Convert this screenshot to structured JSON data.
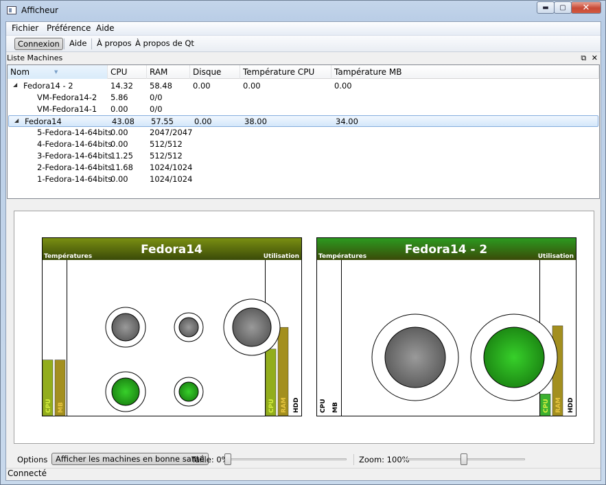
{
  "window": {
    "title": "Afficheur"
  },
  "menu": {
    "items": [
      "Fichier",
      "Préférence",
      "Aide"
    ]
  },
  "toolbar": {
    "connexion": "Connexion",
    "aide": "Aide",
    "apropos": "À propos",
    "apropos_qt": "À propos de Qt"
  },
  "dock": {
    "title": "Liste Machines"
  },
  "table": {
    "columns": [
      "Nom",
      "CPU",
      "RAM",
      "Disque",
      "Température CPU",
      "Tampérature MB"
    ],
    "rows": [
      {
        "level": 0,
        "expanded": true,
        "name": "Fedora14 - 2",
        "cpu": "14.32",
        "ram": "58.48",
        "disk": "0.00",
        "tcpu": "0.00",
        "tmb": "0.00"
      },
      {
        "level": 1,
        "name": "VM-Fedora14-2",
        "cpu": "5.86",
        "ram": "0/0",
        "disk": "",
        "tcpu": "",
        "tmb": ""
      },
      {
        "level": 1,
        "name": "VM-Fedora14-1",
        "cpu": "0.00",
        "ram": "0/0",
        "disk": "",
        "tcpu": "",
        "tmb": ""
      },
      {
        "level": 0,
        "expanded": true,
        "selected": true,
        "name": "Fedora14",
        "cpu": "43.08",
        "ram": "57.55",
        "disk": "0.00",
        "tcpu": "38.00",
        "tmb": "34.00"
      },
      {
        "level": 1,
        "name": "5-Fedora-14-64bits",
        "cpu": "0.00",
        "ram": "2047/2047",
        "disk": "",
        "tcpu": "",
        "tmb": ""
      },
      {
        "level": 1,
        "name": "4-Fedora-14-64bits",
        "cpu": "0.00",
        "ram": "512/512",
        "disk": "",
        "tcpu": "",
        "tmb": ""
      },
      {
        "level": 1,
        "name": "3-Fedora-14-64bits",
        "cpu": "11.25",
        "ram": "512/512",
        "disk": "",
        "tcpu": "",
        "tmb": ""
      },
      {
        "level": 1,
        "name": "2-Fedora-14-64bits",
        "cpu": "11.68",
        "ram": "1024/1024",
        "disk": "",
        "tcpu": "",
        "tmb": ""
      },
      {
        "level": 1,
        "name": "1-Fedora-14-64bits",
        "cpu": "0.00",
        "ram": "1024/1024",
        "disk": "",
        "tcpu": "",
        "tmb": ""
      }
    ]
  },
  "cards": [
    {
      "name": "Fedora14",
      "header_color": "#7a8f12",
      "temp_label": "Températures",
      "util_label": "Utilisation",
      "temp_bars": [
        {
          "label": "CPU",
          "level": 0.36,
          "color": "#92ad1c",
          "text_color": "#d8f040"
        },
        {
          "label": "MB",
          "level": 0.36,
          "color": "#a38f1f",
          "text_color": "#e8c640"
        }
      ],
      "util_bars": [
        {
          "label": "CPU",
          "level": 0.43,
          "color": "#92ad1c",
          "text_color": "#d8f040"
        },
        {
          "label": "RAM",
          "level": 0.57,
          "color": "#a38f1f",
          "text_color": "#e8c640"
        },
        {
          "label": "HDD",
          "level": 0.0,
          "color": "#777777",
          "text_color": "#000000"
        }
      ],
      "vm_circles": [
        {
          "size": "medium",
          "state": "idle"
        },
        {
          "size": "small",
          "state": "idle"
        },
        {
          "size": "large",
          "state": "idle"
        },
        {
          "size": "medium",
          "state": "active"
        },
        {
          "size": "small",
          "state": "active"
        }
      ]
    },
    {
      "name": "Fedora14 - 2",
      "header_color": "#2c9a20",
      "temp_label": "Températures",
      "util_label": "Utilisation",
      "temp_bars": [
        {
          "label": "CPU",
          "level": 0.0,
          "color": "#777777",
          "text_color": "#000000"
        },
        {
          "label": "MB",
          "level": 0.0,
          "color": "#777777",
          "text_color": "#000000"
        }
      ],
      "util_bars": [
        {
          "label": "CPU",
          "level": 0.14,
          "color": "#3cb030",
          "text_color": "#d8f040"
        },
        {
          "label": "RAM",
          "level": 0.58,
          "color": "#a38f1f",
          "text_color": "#e8c640"
        },
        {
          "label": "HDD",
          "level": 0.0,
          "color": "#777777",
          "text_color": "#000000"
        }
      ],
      "vm_circles": [
        {
          "size": "xlarge",
          "state": "idle"
        },
        {
          "size": "xlarge",
          "state": "active"
        }
      ]
    }
  ],
  "bottom": {
    "options_label": "Options",
    "healthy_button": "Afficher les machines en bonne santé",
    "size_label": "Taille: 0%",
    "size_level": 0.0,
    "zoom_label": "Zoom: 100%",
    "zoom_level": 0.5
  },
  "status": {
    "text": "Connecté"
  }
}
